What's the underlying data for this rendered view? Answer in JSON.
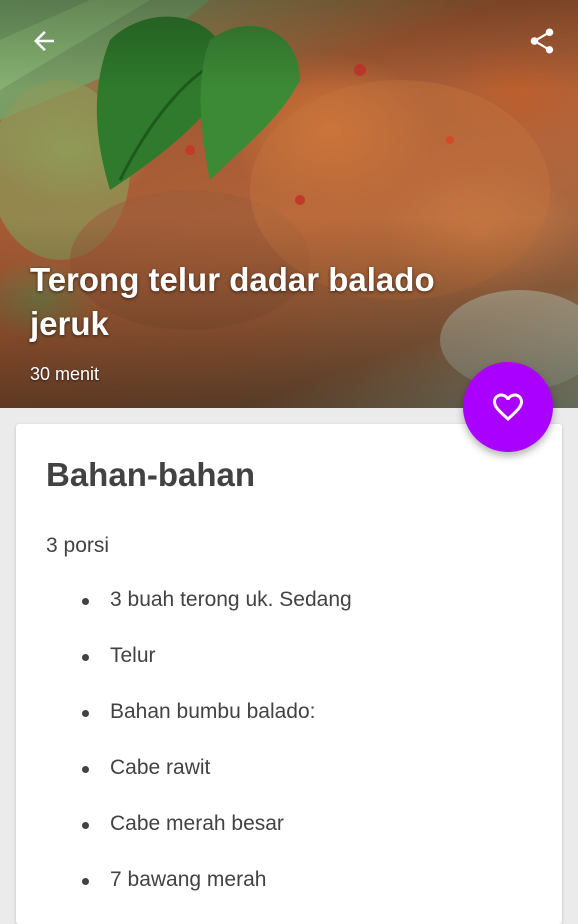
{
  "recipe": {
    "title": "Terong telur dadar balado jeruk",
    "duration": "30 menit"
  },
  "toolbar": {
    "back_icon": "arrow-back-icon",
    "share_icon": "share-icon"
  },
  "favorite": {
    "icon": "heart-outline-icon",
    "color": "#aa00ff"
  },
  "ingredients_section": {
    "heading": "Bahan-bahan",
    "servings": "3 porsi",
    "items": [
      {
        "text": "3 buah terong uk. Sedang"
      },
      {
        "text": "Telur"
      },
      {
        "text": "Bahan bumbu balado:"
      },
      {
        "text": "Cabe rawit"
      },
      {
        "text": "Cabe merah besar"
      },
      {
        "text": "7 bawang merah"
      }
    ]
  }
}
